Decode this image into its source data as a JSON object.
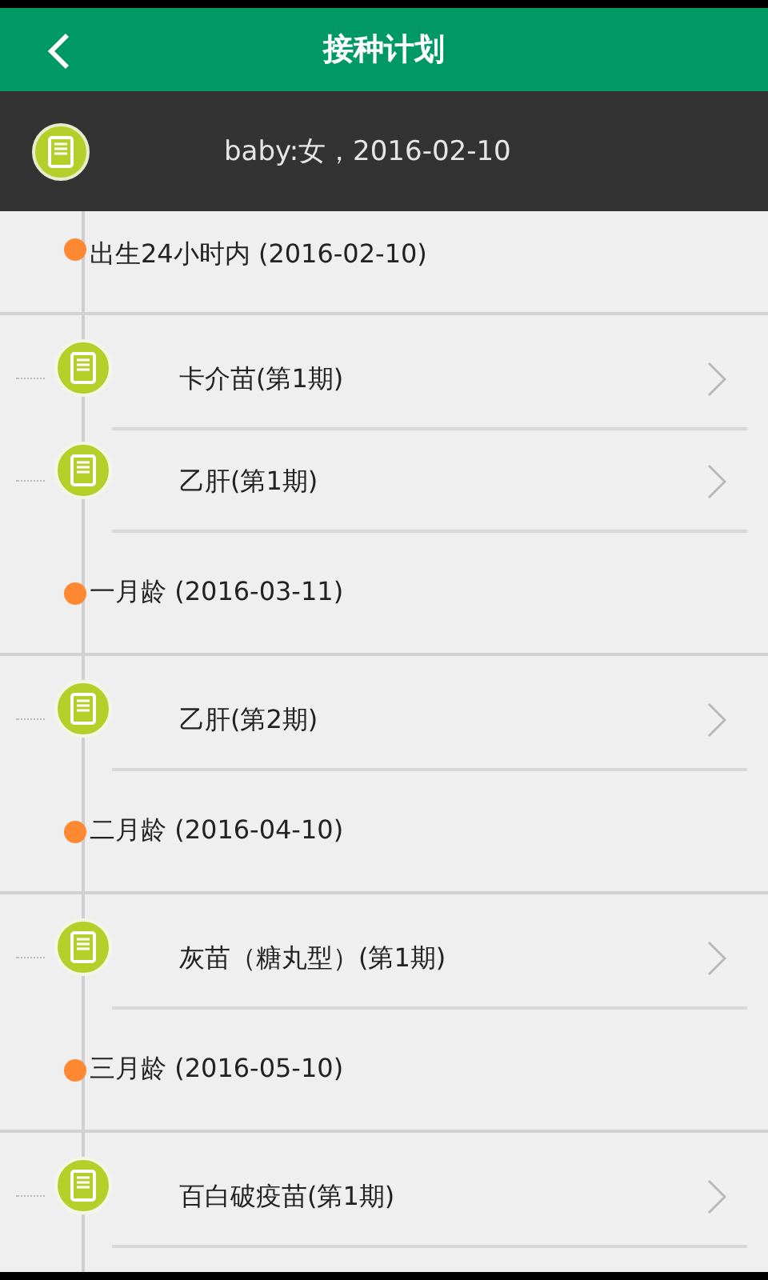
{
  "title": "接种计划",
  "child_info": "baby:女，2016-02-10",
  "groups": [
    {
      "label": "出生24小时内 (2016-02-10)",
      "vaccines": [
        {
          "name": "卡介苗(第1期)"
        },
        {
          "name": "乙肝(第1期)"
        }
      ]
    },
    {
      "label": "一月龄 (2016-03-11)",
      "vaccines": [
        {
          "name": "乙肝(第2期)"
        }
      ]
    },
    {
      "label": "二月龄 (2016-04-10)",
      "vaccines": [
        {
          "name": "灰苗（糖丸型）(第1期)"
        }
      ]
    },
    {
      "label": "三月龄 (2016-05-10)",
      "vaccines": [
        {
          "name": "百白破疫苗(第1期)"
        }
      ]
    }
  ]
}
